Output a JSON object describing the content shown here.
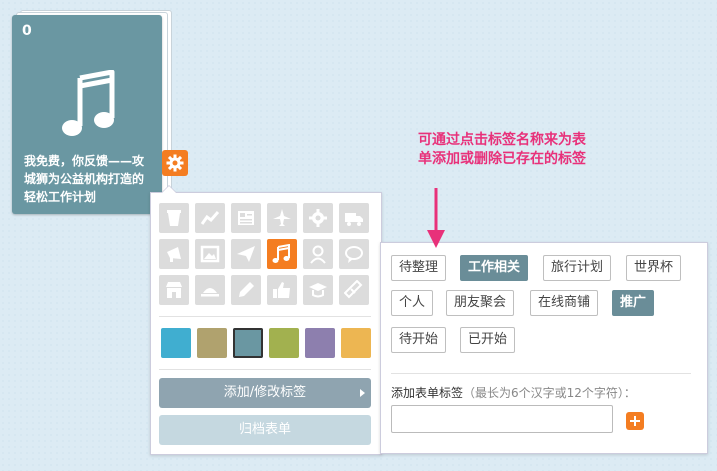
{
  "form_card": {
    "count": "0",
    "title": "我免费，你反馈——攻城狮为公益机构打造的轻松工作计划"
  },
  "icon_grid": [
    "cup-icon",
    "chart-icon",
    "newspaper-icon",
    "airplane-icon",
    "gear-icon",
    "truck-icon",
    "megaphone-icon",
    "picture-icon",
    "paper-plane-icon",
    "music-note-icon",
    "person-icon",
    "speech-bubble-icon",
    "shop-icon",
    "dish-icon",
    "pencil-icon",
    "thumbs-up-icon",
    "graduation-cap-icon",
    "ticket-icon"
  ],
  "selected_icon": "music-note-icon",
  "colors": [
    "#40aed0",
    "#b0a26e",
    "#6a97a2",
    "#a2b14f",
    "#8d7fae",
    "#edb652"
  ],
  "selected_color": "#6a97a2",
  "buttons": {
    "add_edit_tags": "添加/修改标签",
    "archive_form": "归档表单"
  },
  "tags": [
    {
      "label": "待整理",
      "active": false
    },
    {
      "label": "工作相关",
      "active": true
    },
    {
      "label": "旅行计划",
      "active": false
    },
    {
      "label": "世界杯",
      "active": false
    },
    {
      "label": "个人",
      "active": false
    },
    {
      "label": "朋友聚会",
      "active": false
    },
    {
      "label": "在线商铺",
      "active": false
    },
    {
      "label": "推广",
      "active": true
    },
    {
      "label": "待开始",
      "active": false
    },
    {
      "label": "已开始",
      "active": false
    }
  ],
  "add_tag": {
    "label": "添加表单标签",
    "hint": "（最长为6个汉字或12个字符）：",
    "input_value": ""
  },
  "annotation": "可通过点击标签名称来为表单添加或删除已存在的标签",
  "accent_color": "#f47d21"
}
